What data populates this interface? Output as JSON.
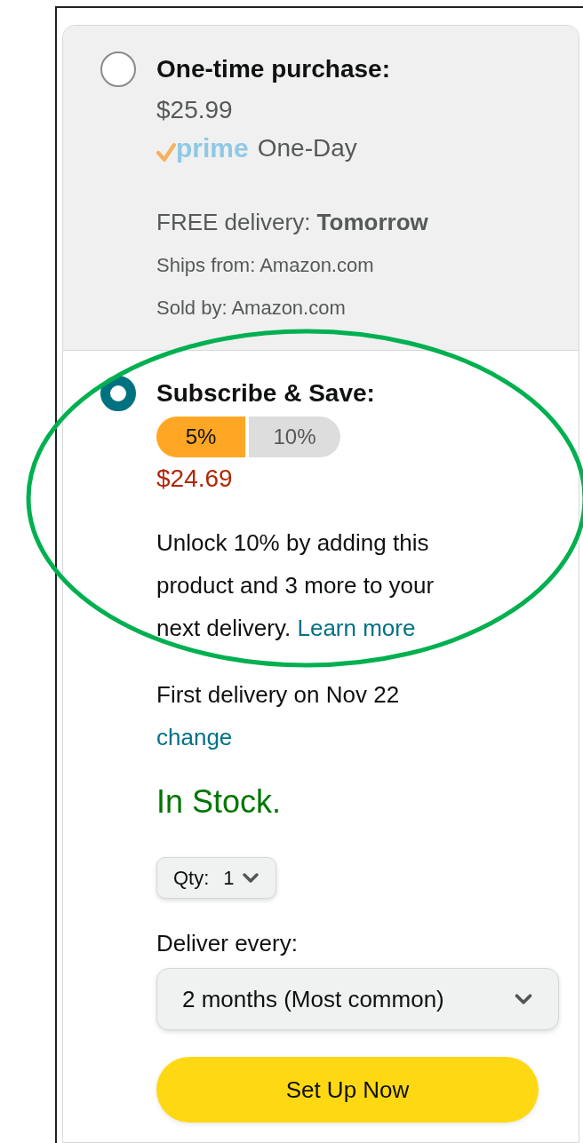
{
  "options": [
    {
      "kind": "one_time",
      "selected": false,
      "title": "One-time purchase:",
      "price": "$25.99",
      "prime_logo": "prime",
      "prime_speed": "One-Day",
      "delivery": "FREE delivery: **Tomorrow**",
      "ships_from": "Ships from: Amazon.com",
      "sold_by": "Sold by: Amazon.com"
    },
    {
      "kind": "subscribe",
      "selected": true,
      "title": "Subscribe & Save:",
      "tiers": [
        {
          "label": "5%",
          "selected": true
        },
        {
          "label": "10%",
          "selected": false
        }
      ],
      "price": "$24.69",
      "message": "Unlock 10% by adding this product and 3 more to your next delivery.",
      "learn_more": "Learn more",
      "first_delivery": "First delivery on Nov 22",
      "change_link": "change",
      "stock": "In Stock.",
      "qty_label": "Qty:",
      "qty_value": "1",
      "deliver_every_label": "Deliver every:",
      "frequency": "2 months (Most common)",
      "button": "Set Up Now"
    }
  ]
}
